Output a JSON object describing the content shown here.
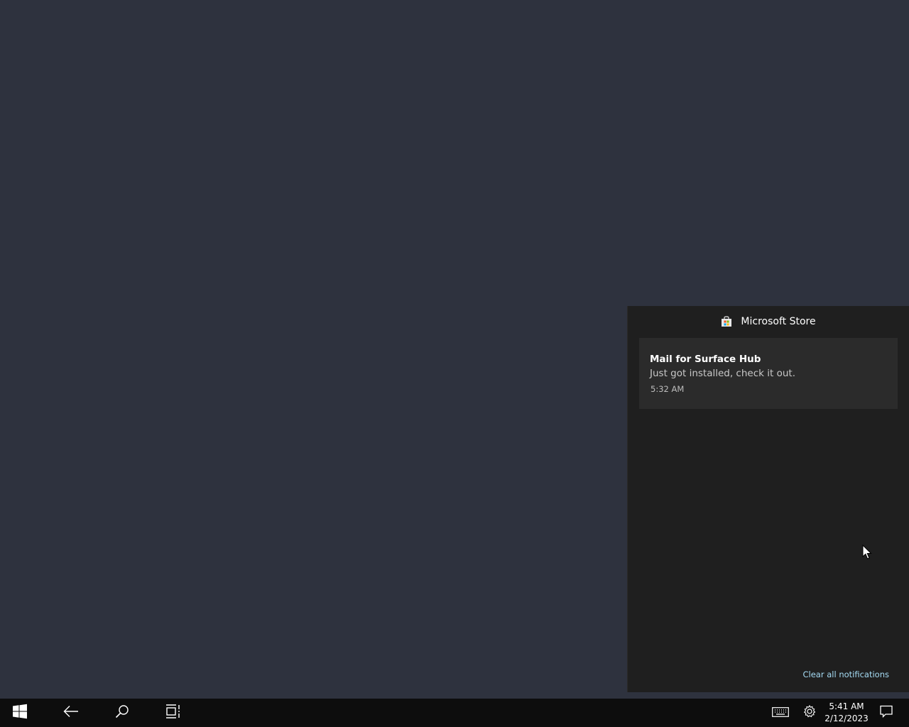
{
  "action_center": {
    "group_title": "Microsoft Store",
    "group_icon": "microsoft-store-icon",
    "notifications": [
      {
        "title": "Mail for Surface Hub",
        "body": "Just got installed, check it out.",
        "time": "5:32 AM"
      }
    ],
    "clear_all_label": "Clear all notifications"
  },
  "taskbar": {
    "buttons": [
      {
        "name": "start-button",
        "icon": "windows-logo-icon"
      },
      {
        "name": "back-button",
        "icon": "back-arrow-icon"
      },
      {
        "name": "search-button",
        "icon": "search-icon"
      },
      {
        "name": "task-view-button",
        "icon": "task-view-icon"
      }
    ],
    "tray": {
      "keyboard_icon": "touch-keyboard-icon",
      "settings_icon": "gear-icon",
      "time": "5:41 AM",
      "date": "2/12/2023",
      "notifications_icon": "action-center-icon"
    }
  },
  "colors": {
    "desktop_background": "#2e323e",
    "panel_background": "#1f1f1f",
    "card_background": "#2b2b2b",
    "taskbar_background": "#0d0d0d",
    "link_accent": "#a6dcf5"
  }
}
